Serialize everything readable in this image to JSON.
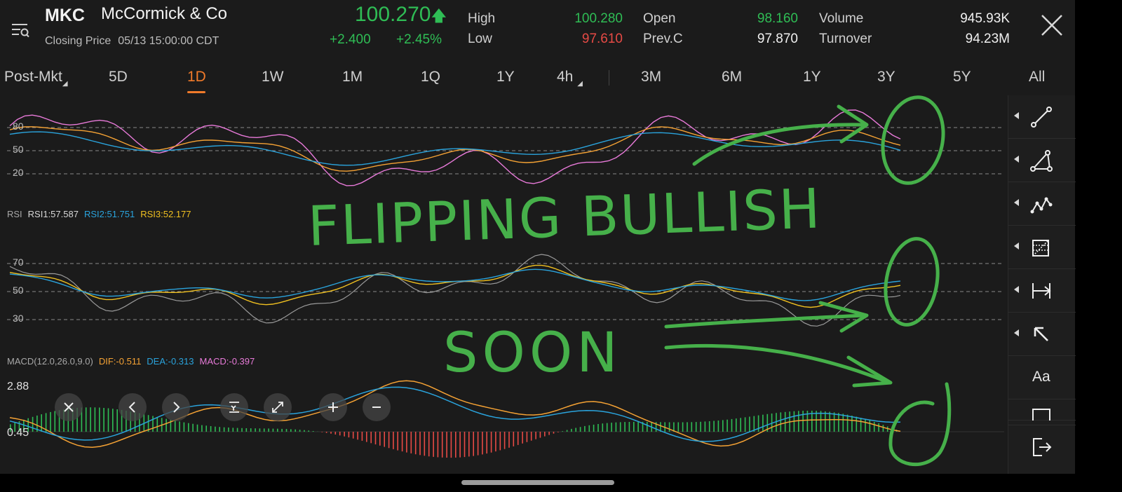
{
  "header": {
    "symbol": "MKC",
    "company": "McCormick & Co",
    "closing_label": "Closing Price",
    "closing_time": "05/13 15:00:00 CDT",
    "price": "100.270",
    "change": "+2.400",
    "change_pct": "+2.45%",
    "stats": {
      "high_label": "High",
      "high": "100.280",
      "low_label": "Low",
      "low": "97.610",
      "open_label": "Open",
      "open": "98.160",
      "prevc_label": "Prev.C",
      "prevc": "97.870",
      "volume_label": "Volume",
      "volume": "945.93K",
      "turnover_label": "Turnover",
      "turnover": "94.23M"
    }
  },
  "tabs": {
    "post_mkt": "Post-Mkt",
    "d5": "5D",
    "d1": "1D",
    "w1": "1W",
    "m1": "1M",
    "q1": "1Q",
    "y1": "1Y",
    "h4": "4h",
    "m3": "3M",
    "m6": "6M",
    "y1b": "1Y",
    "y3": "3Y",
    "y5": "5Y",
    "all": "All",
    "active": "1D"
  },
  "kdj_panel": {
    "axis": {
      "top": "80",
      "mid": "50",
      "low": "20"
    }
  },
  "rsi_panel": {
    "name": "RSI",
    "rsi1": "RSI1:57.587",
    "rsi2": "RSI2:51.751",
    "rsi3": "RSI3:52.177",
    "axis": {
      "top": "70",
      "mid": "50",
      "low": "30"
    }
  },
  "macd_panel": {
    "name": "MACD(12.0,26.0,9.0)",
    "dif": "DIF:-0.511",
    "dea": "DEA:-0.313",
    "macd": "MACD:-0.397",
    "axis": {
      "top": "2.88",
      "mid": "0.45"
    }
  },
  "annotation": {
    "line1": "FLIPPING BULLISH",
    "line2": "SOON"
  },
  "tools": {
    "text_tool": "Aa"
  },
  "colors": {
    "up": "#2fbd55",
    "down": "#e64a45",
    "accent": "#f07a2a",
    "line_k": "#e87ad9",
    "line_d": "#f5a234",
    "line_j": "#2aa3dc",
    "rsi1": "#9a9a9a",
    "rsi2": "#2aa3dc",
    "rsi3": "#f0c020",
    "dif": "#f5a234",
    "dea": "#2aa3dc",
    "handwriting": "#46b04a"
  }
}
